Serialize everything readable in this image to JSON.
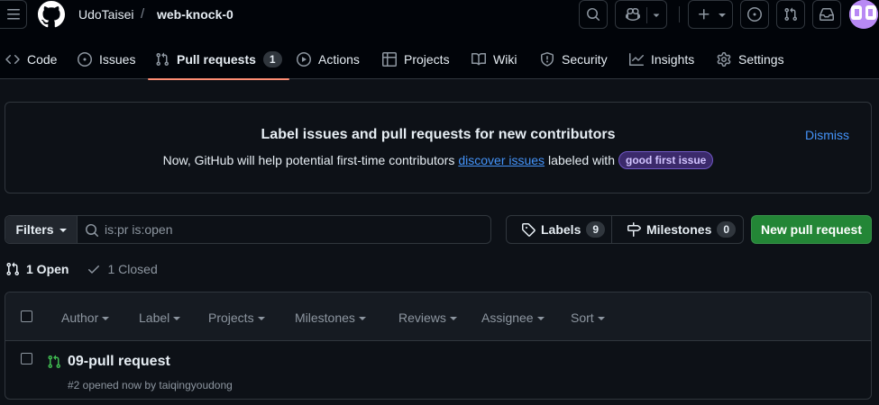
{
  "header": {
    "owner": "UdoTaisei",
    "separator": "/",
    "repo": "web-knock-0"
  },
  "nav": {
    "tabs": [
      {
        "label": "Code",
        "icon": "code-icon"
      },
      {
        "label": "Issues",
        "icon": "issue-opened-icon"
      },
      {
        "label": "Pull requests",
        "icon": "git-pull-request-icon",
        "count": "1",
        "active": true
      },
      {
        "label": "Actions",
        "icon": "play-icon"
      },
      {
        "label": "Projects",
        "icon": "table-icon"
      },
      {
        "label": "Wiki",
        "icon": "book-icon"
      },
      {
        "label": "Security",
        "icon": "shield-icon"
      },
      {
        "label": "Insights",
        "icon": "graph-icon"
      },
      {
        "label": "Settings",
        "icon": "gear-icon"
      }
    ]
  },
  "banner": {
    "title": "Label issues and pull requests for new contributors",
    "text_before": "Now, GitHub will help potential first-time contributors",
    "link": "discover issues",
    "text_after": "labeled with",
    "label_badge": "good first issue",
    "dismiss": "Dismiss"
  },
  "toolbar": {
    "filters_label": "Filters",
    "search_placeholder": "is:pr is:open",
    "labels_label": "Labels",
    "labels_count": "9",
    "milestones_label": "Milestones",
    "milestones_count": "0",
    "new_pr_label": "New pull request"
  },
  "states": {
    "open": "1 Open",
    "closed": "1 Closed"
  },
  "list": {
    "sort_menus": [
      "Author",
      "Label",
      "Projects",
      "Milestones",
      "Reviews",
      "Assignee",
      "Sort"
    ],
    "rows": [
      {
        "title": "09-pull request",
        "meta": "#2 opened now by taiqingyoudong"
      }
    ]
  },
  "colors": {
    "background": "#0d1117",
    "accent_underline": "#fd8c73",
    "primary_button": "#238636",
    "link": "#4493f8",
    "open_icon": "#3fb950"
  }
}
